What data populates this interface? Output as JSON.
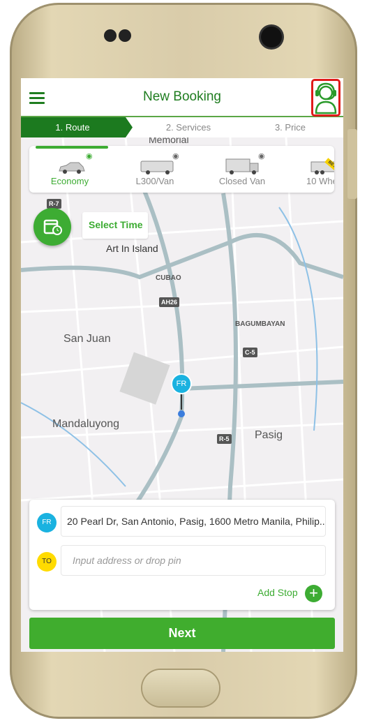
{
  "header": {
    "title": "New Booking",
    "menu_icon": "hamburger-icon",
    "support_icon": "support-agent-icon"
  },
  "steps": [
    "1. Route",
    "2. Services",
    "3. Price"
  ],
  "vehicles": [
    {
      "label": "Economy",
      "selected": true
    },
    {
      "label": "L300/Van"
    },
    {
      "label": "Closed Van"
    },
    {
      "label": "10 Whe",
      "badge": "BETA"
    }
  ],
  "select_time": "Select Time",
  "map": {
    "labels": [
      "Memorial",
      "Art In Island",
      "CUBAO",
      "BAGUMBAYAN",
      "San Juan",
      "Mandaluyong",
      "Pasig"
    ],
    "shields": [
      "R-7",
      "AH26",
      "C-5",
      "R-5"
    ],
    "pin": "FR"
  },
  "route": {
    "from_badge": "FR",
    "from_value": "20 Pearl Dr, San Antonio, Pasig, 1600 Metro Manila, Philip...",
    "to_badge": "TO",
    "to_placeholder": "Input address or drop pin",
    "add_stop": "Add Stop"
  },
  "next_label": "Next",
  "colors": {
    "primary": "#3dac33",
    "dark_green": "#1c7a1f",
    "from": "#1ab2e0",
    "to": "#ffdb00",
    "highlight": "#e01b1b"
  }
}
